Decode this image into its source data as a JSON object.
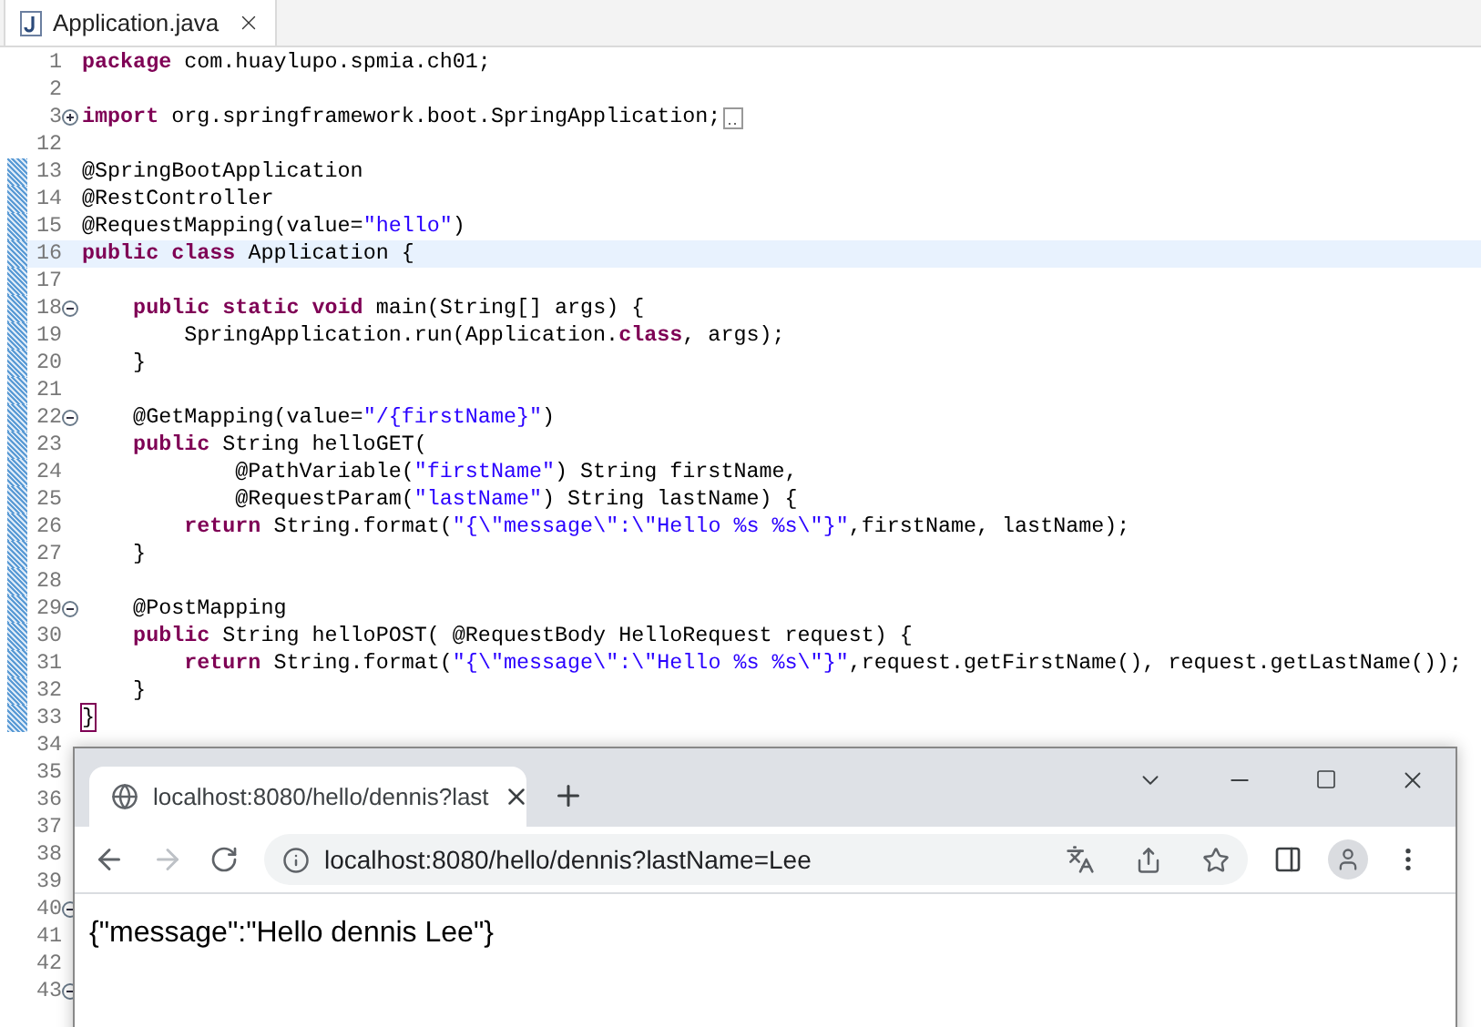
{
  "editor": {
    "tab": {
      "title": "Application.java",
      "selected": true
    },
    "lines": [
      {
        "number": "1",
        "changed": false,
        "current": false,
        "tokens": [
          {
            "kind": "keyword",
            "text": "package"
          },
          {
            "kind": "plain",
            "text": " com.huaylupo.spmia.ch01;"
          }
        ]
      },
      {
        "number": "2",
        "changed": false,
        "current": false
      },
      {
        "number": "3",
        "foldable": true,
        "collapsed": true,
        "changed": false,
        "current": false,
        "tokens": [
          {
            "kind": "keyword",
            "text": "import"
          },
          {
            "kind": "plain",
            "text": " org.springframework.boot.SpringApplication;"
          }
        ]
      },
      {
        "number": "12",
        "changed": false,
        "current": false
      },
      {
        "number": "13",
        "changed": true,
        "current": false,
        "tokens": [
          {
            "kind": "plain",
            "text": "@SpringBootApplication"
          }
        ]
      },
      {
        "number": "14",
        "changed": true,
        "current": false,
        "tokens": [
          {
            "kind": "plain",
            "text": "@RestController"
          }
        ]
      },
      {
        "number": "15",
        "changed": true,
        "current": false,
        "tokens": [
          {
            "kind": "plain",
            "text": "@RequestMapping(value="
          },
          {
            "kind": "string",
            "text": "\"hello\""
          },
          {
            "kind": "plain",
            "text": ")"
          }
        ]
      },
      {
        "number": "16",
        "changed": true,
        "current": true,
        "tokens": [
          {
            "kind": "keyword",
            "text": "public"
          },
          {
            "kind": "keyword",
            "text": " class"
          },
          {
            "kind": "plain",
            "text": " Application {"
          }
        ]
      },
      {
        "number": "17",
        "changed": true,
        "current": false
      },
      {
        "number": "18",
        "foldable": true,
        "collapsed": false,
        "changed": true,
        "current": false,
        "tokens": [
          {
            "kind": "keyword",
            "text": "    public"
          },
          {
            "kind": "keyword",
            "text": " static"
          },
          {
            "kind": "keyword",
            "text": " void"
          },
          {
            "kind": "plain",
            "text": " main(String[] args) {"
          }
        ]
      },
      {
        "number": "19",
        "changed": true,
        "current": false,
        "tokens": [
          {
            "kind": "plain",
            "text": "        SpringApplication.run(Application."
          },
          {
            "kind": "keyword",
            "text": "class"
          },
          {
            "kind": "plain",
            "text": ", args);"
          }
        ]
      },
      {
        "number": "20",
        "changed": true,
        "current": false,
        "tokens": [
          {
            "kind": "plain",
            "text": "    }"
          }
        ]
      },
      {
        "number": "21",
        "changed": true,
        "current": false
      },
      {
        "number": "22",
        "foldable": true,
        "collapsed": false,
        "changed": true,
        "current": false,
        "tokens": [
          {
            "kind": "plain",
            "text": "    @GetMapping(value="
          },
          {
            "kind": "string",
            "text": "\"/{firstName}\""
          },
          {
            "kind": "plain",
            "text": ")"
          }
        ]
      },
      {
        "number": "23",
        "changed": true,
        "current": false,
        "tokens": [
          {
            "kind": "keyword",
            "text": "    public"
          },
          {
            "kind": "plain",
            "text": " String helloGET("
          }
        ]
      },
      {
        "number": "24",
        "changed": true,
        "current": false,
        "tokens": [
          {
            "kind": "plain",
            "text": "            @PathVariable("
          },
          {
            "kind": "string",
            "text": "\"firstName\""
          },
          {
            "kind": "plain",
            "text": ") String firstName,"
          }
        ]
      },
      {
        "number": "25",
        "changed": true,
        "current": false,
        "tokens": [
          {
            "kind": "plain",
            "text": "            @RequestParam("
          },
          {
            "kind": "string",
            "text": "\"lastName\""
          },
          {
            "kind": "plain",
            "text": ") String lastName) {"
          }
        ]
      },
      {
        "number": "26",
        "changed": true,
        "current": false,
        "tokens": [
          {
            "kind": "keyword",
            "text": "        return"
          },
          {
            "kind": "plain",
            "text": " String.format("
          },
          {
            "kind": "string",
            "text": "\"{\\\"message\\\":\\\"Hello %s %s\\\"}\""
          },
          {
            "kind": "plain",
            "text": ",firstName, lastName);"
          }
        ]
      },
      {
        "number": "27",
        "changed": true,
        "current": false,
        "tokens": [
          {
            "kind": "plain",
            "text": "    }"
          }
        ]
      },
      {
        "number": "28",
        "changed": true,
        "current": false
      },
      {
        "number": "29",
        "foldable": true,
        "collapsed": false,
        "changed": true,
        "current": false,
        "tokens": [
          {
            "kind": "plain",
            "text": "    @PostMapping"
          }
        ]
      },
      {
        "number": "30",
        "changed": true,
        "current": false,
        "tokens": [
          {
            "kind": "keyword",
            "text": "    public"
          },
          {
            "kind": "plain",
            "text": " String helloPOST( @RequestBody HelloRequest request) {"
          }
        ]
      },
      {
        "number": "31",
        "changed": true,
        "current": false,
        "tokens": [
          {
            "kind": "keyword",
            "text": "        return"
          },
          {
            "kind": "plain",
            "text": " String.format("
          },
          {
            "kind": "string",
            "text": "\"{\\\"message\\\":\\\"Hello %s %s\\\"}\""
          },
          {
            "kind": "plain",
            "text": ",request.getFirstName(), request.getLastName());"
          }
        ]
      },
      {
        "number": "32",
        "changed": true,
        "current": false,
        "tokens": [
          {
            "kind": "plain",
            "text": "    }"
          }
        ]
      },
      {
        "number": "33",
        "changed": true,
        "current": false,
        "tokens": [
          {
            "kind": "bracket_match",
            "text": "}"
          }
        ]
      },
      {
        "number": "34",
        "changed": false,
        "current": false
      },
      {
        "number": "35",
        "changed": false,
        "current": false
      },
      {
        "number": "36",
        "changed": false,
        "current": false
      },
      {
        "number": "37",
        "changed": false,
        "current": false
      },
      {
        "number": "38",
        "changed": false,
        "current": false
      },
      {
        "number": "39",
        "changed": false,
        "current": false
      },
      {
        "number": "40",
        "foldable": true,
        "collapsed": false,
        "changed": false,
        "current": false
      },
      {
        "number": "41",
        "changed": false,
        "current": false
      },
      {
        "number": "42",
        "changed": false,
        "current": false
      },
      {
        "number": "43",
        "foldable": true,
        "collapsed": false,
        "changed": false,
        "current": false
      }
    ]
  },
  "browser": {
    "tab": {
      "title": "localhost:8080/hello/dennis?last",
      "selected": true
    },
    "forward_enabled": false,
    "address": "localhost:8080/hello/dennis?lastName=Lee",
    "content": "{\"message\":\"Hello dennis Lee\"}"
  }
}
